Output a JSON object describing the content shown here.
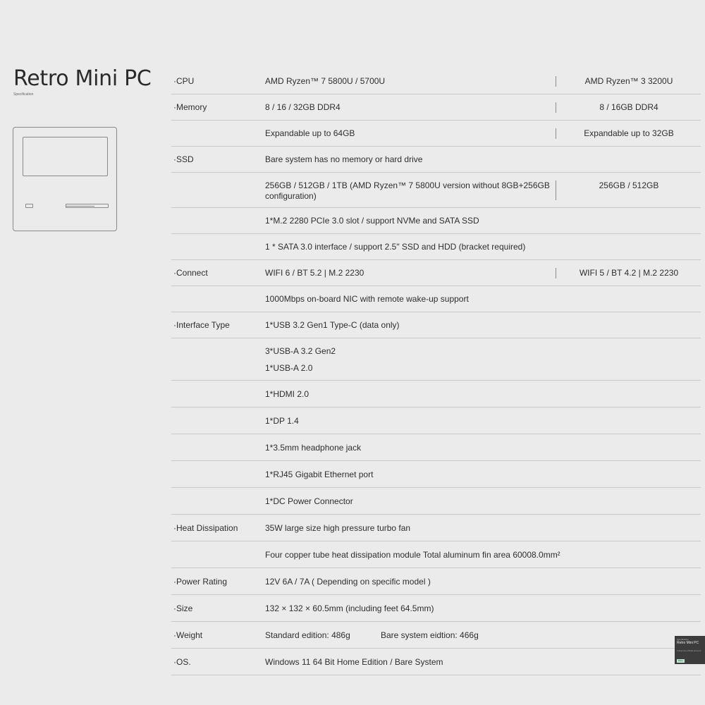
{
  "header": {
    "title": "Retro Mini PC",
    "subtitle": "Specification"
  },
  "specs": {
    "cpu": {
      "label": "·CPU",
      "v1": "AMD Ryzen™ 7 5800U / 5700U",
      "v2": "AMD Ryzen™ 3 3200U"
    },
    "memory": {
      "label": "·Memory",
      "v1": "8 / 16 / 32GB DDR4",
      "v2": "8 / 16GB DDR4"
    },
    "memory_exp": {
      "v1": "Expandable up to 64GB",
      "v2": "Expandable up to 32GB"
    },
    "ssd": {
      "label": "·SSD",
      "v1": "Bare system has no memory or hard drive"
    },
    "ssd_cap": {
      "v1": "256GB / 512GB / 1TB (AMD Ryzen™ 7 5800U version without 8GB+256GB configuration)",
      "v2": "256GB / 512GB"
    },
    "ssd_slot": {
      "v1": "1*M.2 2280 PCIe 3.0 slot / support NVMe and SATA SSD"
    },
    "ssd_sata": {
      "v1": "1 * SATA 3.0 interface / support 2.5\" SSD and HDD (bracket required)"
    },
    "connect": {
      "label": "·Connect",
      "v1": "WIFI 6 / BT 5.2 | M.2 2230",
      "v2": "WIFI 5 / BT 4.2 | M.2 2230"
    },
    "connect_nic": {
      "v1": "1000Mbps on-board NIC with remote wake-up support"
    },
    "iface": {
      "label": "·Interface Type",
      "v1": "1*USB 3.2 Gen1 Type-C (data only)"
    },
    "iface_usba": {
      "line1": "3*USB-A 3.2 Gen2",
      "line2": "1*USB-A 2.0"
    },
    "iface_hdmi": {
      "v1": "1*HDMI 2.0"
    },
    "iface_dp": {
      "v1": "1*DP 1.4"
    },
    "iface_audio": {
      "v1": "1*3.5mm headphone jack"
    },
    "iface_rj45": {
      "v1": "1*RJ45 Gigabit Ethernet port"
    },
    "iface_dc": {
      "v1": "1*DC Power Connector"
    },
    "heat": {
      "label": "·Heat Dissipation",
      "v1": "35W large size high pressure turbo fan"
    },
    "heat_module": {
      "v1": "Four copper tube heat dissipation module Total aluminum fin area 60008.0mm²"
    },
    "power": {
      "label": "·Power Rating",
      "v1": "12V 6A / 7A ( Depending on specific model )"
    },
    "size": {
      "label": "·Size",
      "v1": "132 × 132 × 60.5mm (including feet 64.5mm)"
    },
    "weight": {
      "label": "·Weight",
      "v1": "Standard edition: 486g",
      "v2": "Bare system eidtion: 466g"
    },
    "os": {
      "label": "·OS.",
      "v1": "Windows 11 64 Bit Home Edition / Bare System"
    }
  },
  "thumbnail": {
    "line1": "Specification",
    "line2": "Retro Mini PC",
    "line3": "Follow the official account",
    "line4": "More"
  }
}
